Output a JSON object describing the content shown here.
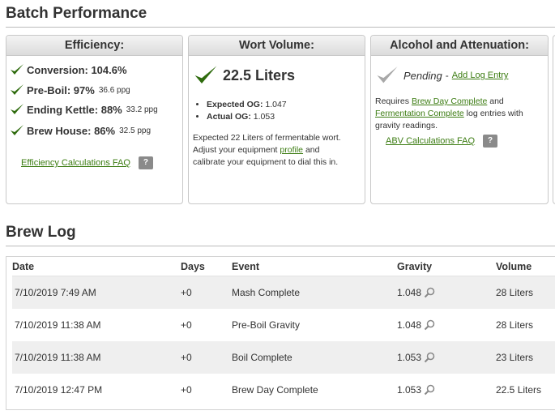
{
  "batch": {
    "title": "Batch Performance",
    "efficiency": {
      "header": "Efficiency:",
      "items": [
        {
          "label": "Conversion: 104.6%",
          "sub": ""
        },
        {
          "label": "Pre-Boil: 97%",
          "sub": "36.6 ppg"
        },
        {
          "label": "Ending Kettle: 88%",
          "sub": "33.2 ppg"
        },
        {
          "label": "Brew House: 86%",
          "sub": "32.5 ppg"
        }
      ],
      "faq": "Efficiency Calculations FAQ",
      "help": "?"
    },
    "wort": {
      "header": "Wort Volume:",
      "volume": "22.5 Liters",
      "og_expected_label": "Expected OG:",
      "og_expected": "1.047",
      "og_actual_label": "Actual OG:",
      "og_actual": "1.053",
      "note_1": "Expected 22 Liters of fermentable wort.",
      "note_2": "Adjust your equipment",
      "note_link": "profile",
      "note_3": "and",
      "note_4": "calibrate your equipment to dial this in."
    },
    "alcohol": {
      "header": "Alcohol and Attenuation:",
      "status": "Pending",
      "dash": "-",
      "add_link": "Add Log Entry",
      "req_1": "Requires",
      "req_link_1": "Brew Day Complete",
      "req_2": "and",
      "req_link_2": "Fermentation Complete",
      "req_3": "log entries with",
      "req_4": "gravity readings.",
      "faq": "ABV Calculations FAQ",
      "help": "?"
    }
  },
  "brewlog": {
    "title": "Brew Log",
    "columns": [
      "Date",
      "Days",
      "Event",
      "Gravity",
      "Volume"
    ],
    "rows": [
      {
        "date": "7/10/2019 7:49 AM",
        "days": "+0",
        "event": "Mash Complete",
        "gravity": "1.048",
        "volume": "28 Liters"
      },
      {
        "date": "7/10/2019 11:38 AM",
        "days": "+0",
        "event": "Pre-Boil Gravity",
        "gravity": "1.048",
        "volume": "28 Liters"
      },
      {
        "date": "7/10/2019 11:38 AM",
        "days": "+0",
        "event": "Boil Complete",
        "gravity": "1.053",
        "volume": "23 Liters"
      },
      {
        "date": "7/10/2019 12:47 PM",
        "days": "+0",
        "event": "Brew Day Complete",
        "gravity": "1.053",
        "volume": "22.5 Liters"
      }
    ]
  },
  "colors": {
    "accent": "#2e6b0d",
    "link": "#3c7c12",
    "pending": "#9a9a9a"
  }
}
